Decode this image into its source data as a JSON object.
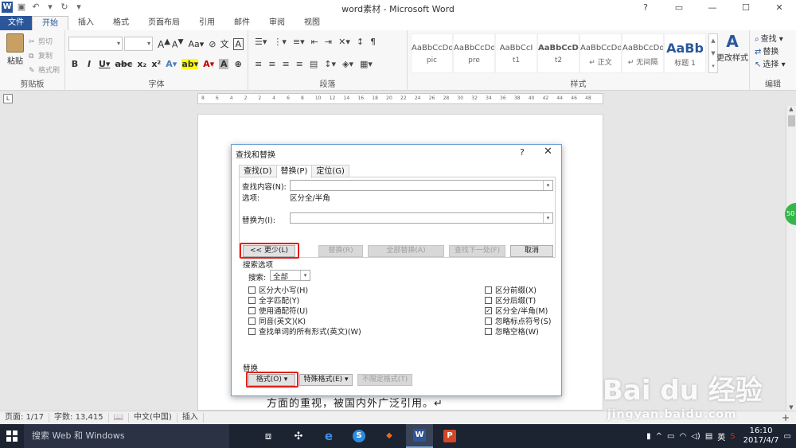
{
  "window": {
    "title": "word素材 - Microsoft Word",
    "controls": [
      "?",
      "▭",
      "—",
      "☐",
      "✕"
    ]
  },
  "ribbon_tabs": [
    "文件",
    "开始",
    "插入",
    "格式",
    "页面布局",
    "引用",
    "邮件",
    "审阅",
    "视图"
  ],
  "clipboard": {
    "paste": "粘贴",
    "cut": "剪切",
    "copy": "复制",
    "format_painter": "格式刷",
    "label": "剪贴板"
  },
  "font_group": {
    "label": "字体"
  },
  "paragraph_group": {
    "label": "段落"
  },
  "styles_group": {
    "label": "样式",
    "items": [
      {
        "preview": "AaBbCcDd",
        "name": "pic"
      },
      {
        "preview": "AaBbCcDd",
        "name": "pre"
      },
      {
        "preview": "AaBbCcI",
        "name": "t1"
      },
      {
        "preview": "AaBbCcDd",
        "name": "t2"
      },
      {
        "preview": "AaBbCcDd",
        "name": "↵ 正文"
      },
      {
        "preview": "AaBbCcDd",
        "name": "↵ 无间隔"
      },
      {
        "preview": "AaBb",
        "name": "标题 1"
      }
    ],
    "change_styles": "更改样式"
  },
  "editing_group": {
    "label": "编辑",
    "find": "查找",
    "replace": "替换",
    "select": "选择"
  },
  "ruler_ticks": [
    "8",
    "6",
    "4",
    "2",
    "2",
    "4",
    "6",
    "8",
    "10",
    "12",
    "14",
    "16",
    "18",
    "20",
    "22",
    "24",
    "26",
    "28",
    "30",
    "32",
    "34",
    "36",
    "38",
    "40",
    "42",
    "44",
    "46",
    "48"
  ],
  "document": {
    "visible_line": "方面的重视，被国内外广泛引用。↵"
  },
  "statusbar": {
    "page": "页面: 1/17",
    "words": "字数: 13,415",
    "language": "中文(中国)",
    "mode": "插入",
    "zoom_plus": "+"
  },
  "watermark": {
    "brand": "Bai du 经验",
    "url": "jingyan.baidu.com"
  },
  "taskbar": {
    "search_placeholder": "搜索 Web 和 Windows",
    "time": "16:10",
    "date": "2017/4/7",
    "ime": "英"
  },
  "dialog": {
    "title": "查找和替换",
    "help": "?",
    "close": "✕",
    "tabs": [
      "查找(D)",
      "替换(P)",
      "定位(G)"
    ],
    "active_tab": 1,
    "find_label": "查找内容(N):",
    "find_value": "",
    "options_label": "选项:",
    "options_value": "区分全/半角",
    "replace_label": "替换为(I):",
    "replace_value": "",
    "less_button": "<< 更少(L)",
    "replace_button": "替换(R)",
    "replace_all_button": "全部替换(A)",
    "find_next_button": "查找下一处(F)",
    "cancel_button": "取消",
    "search_options_label": "搜索选项",
    "search_label": "搜索:",
    "search_value": "全部",
    "left_checks": [
      {
        "label": "区分大小写(H)",
        "checked": false
      },
      {
        "label": "全字匹配(Y)",
        "checked": false
      },
      {
        "label": "使用通配符(U)",
        "checked": false
      },
      {
        "label": "同音(英文)(K)",
        "checked": false
      },
      {
        "label": "查找单词的所有形式(英文)(W)",
        "checked": false
      }
    ],
    "right_checks": [
      {
        "label": "区分前缀(X)",
        "checked": false
      },
      {
        "label": "区分后缀(T)",
        "checked": false
      },
      {
        "label": "区分全/半角(M)",
        "checked": true
      },
      {
        "label": "忽略标点符号(S)",
        "checked": false
      },
      {
        "label": "忽略空格(W)",
        "checked": false
      }
    ],
    "replace_section_label": "替换",
    "format_button": "格式(O) ▾",
    "special_button": "特殊格式(E) ▾",
    "no_format_button": "不限定格式(T)"
  }
}
